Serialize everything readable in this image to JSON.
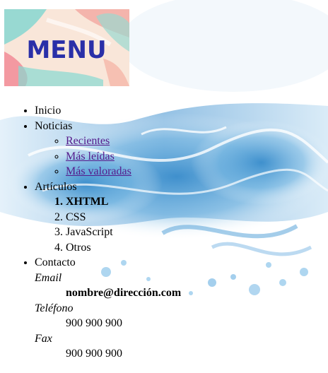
{
  "banner": {
    "text": "MENU"
  },
  "menu": {
    "inicio": "Inicio",
    "noticias": {
      "label": "Noticias",
      "items": [
        "Recientes",
        "Más leídas",
        "Más valoradas"
      ]
    },
    "articulos": {
      "label": "Artículos",
      "items": [
        "XHTML",
        "CSS",
        "JavaScript",
        "Otros"
      ]
    },
    "contacto": {
      "label": "Contacto",
      "email_label": "Email",
      "email_value": "nombre@dirección.com",
      "telefono_label": "Teléfono",
      "telefono_value": "900 900 900",
      "fax_label": "Fax",
      "fax_value": "900 900 900"
    }
  }
}
